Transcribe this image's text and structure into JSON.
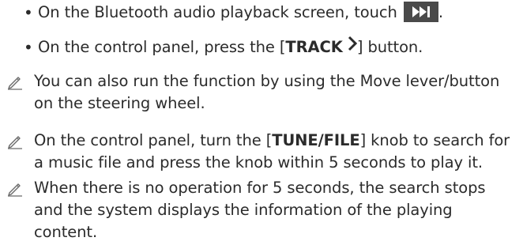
{
  "bullets": [
    {
      "prefix": "On the Bluetooth audio playback screen, touch ",
      "icon": "next-track-icon",
      "suffix": "."
    },
    {
      "prefix": "On the control panel, press the [",
      "button_label": "TRACK",
      "chevron": "chevron-right-icon",
      "suffix": "] button."
    }
  ],
  "notes": [
    {
      "icon": "pencil-note-icon",
      "text": "You can also run the function by using the Move lever/button on the steering wheel."
    },
    {
      "icon": "pencil-note-icon",
      "prefix": "On the control panel, turn the [",
      "knob_label": "TUNE/FILE",
      "suffix": "] knob to search for a music file and press the knob within 5 seconds to play it."
    },
    {
      "icon": "pencil-note-icon",
      "text": "When there is no operation for 5 seconds, the search stops and the system displays the information of the playing content."
    }
  ],
  "colors": {
    "text": "#2b2b2b",
    "icon_bg": "#4a4a4a",
    "pencil": "#6a6a6a"
  }
}
